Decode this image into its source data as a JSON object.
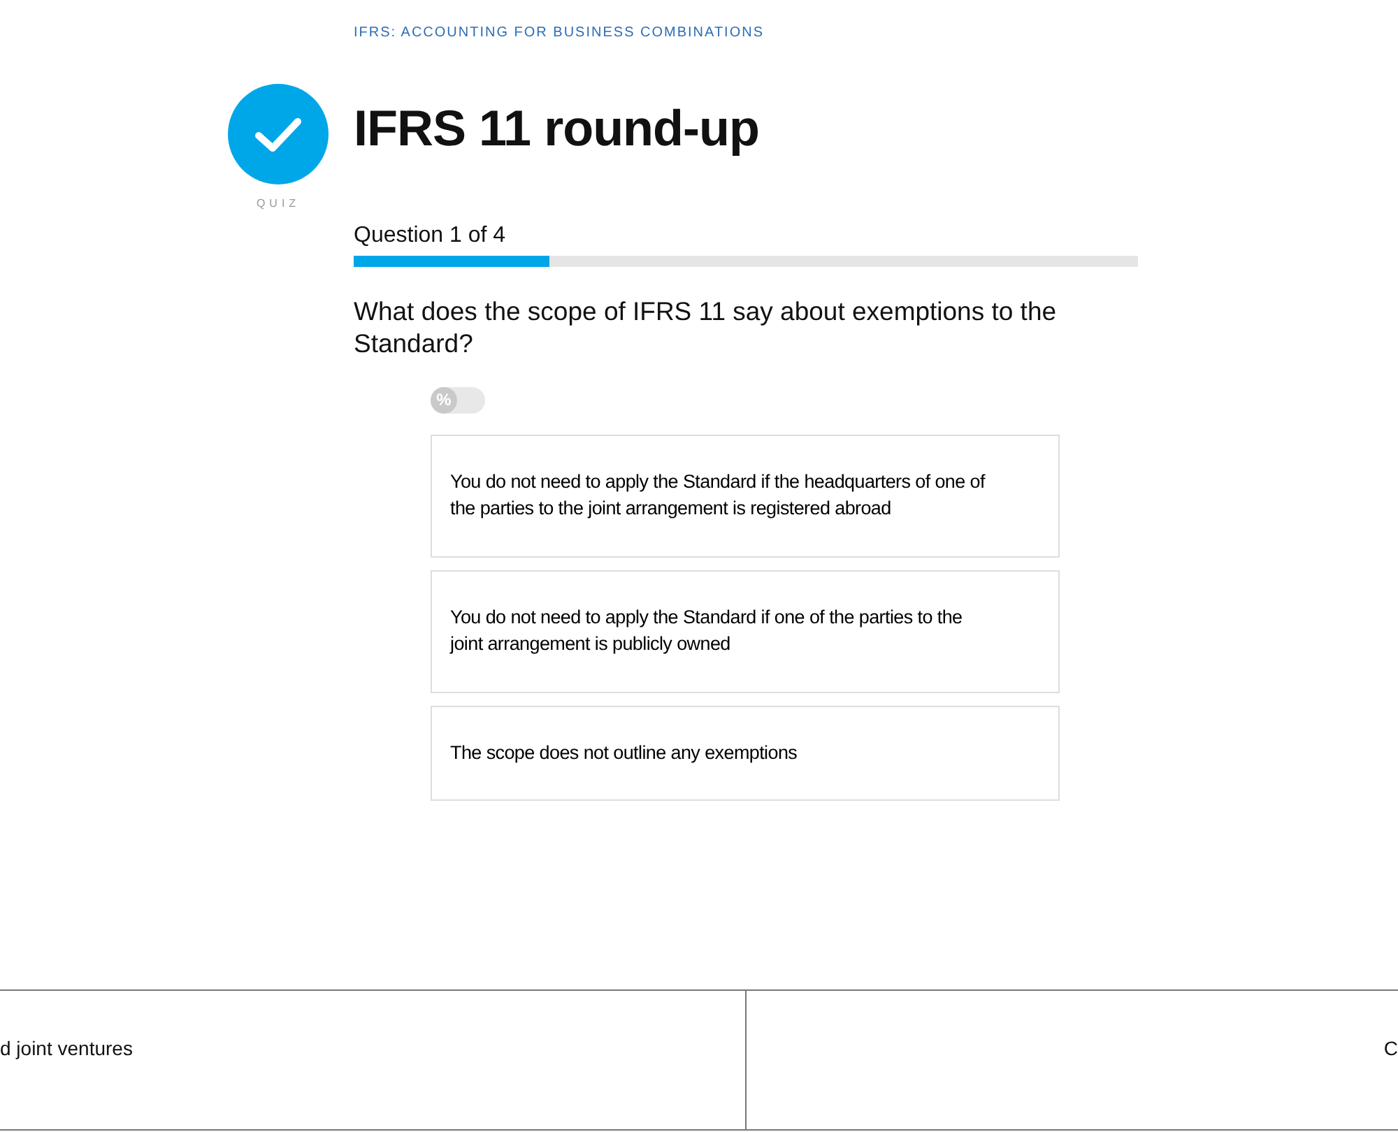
{
  "course": "IFRS: ACCOUNTING FOR BUSINESS COMBINATIONS",
  "quiz": {
    "badge": "QUIZ",
    "title": "IFRS 11 round-up"
  },
  "progress": {
    "label": "Question 1 of 4",
    "level": 0.25
  },
  "question": "What does the scope of IFRS 11 say about exemptions to the Standard?",
  "percent_toggle": {
    "symbol": "%",
    "on": false
  },
  "options": [
    {
      "text": "You do not need to apply the Standard if the headquarters of one of the parties to the joint arrangement is registered abroad",
      "selected": false
    },
    {
      "text": "You do not need to apply the Standard if one of the parties to the joint arrangement is publicly owned",
      "selected": false
    },
    {
      "text": "The scope does not outline any exemptions",
      "selected": false
    }
  ],
  "footer_nav": {
    "previous": "d joint ventures",
    "next": "C"
  }
}
